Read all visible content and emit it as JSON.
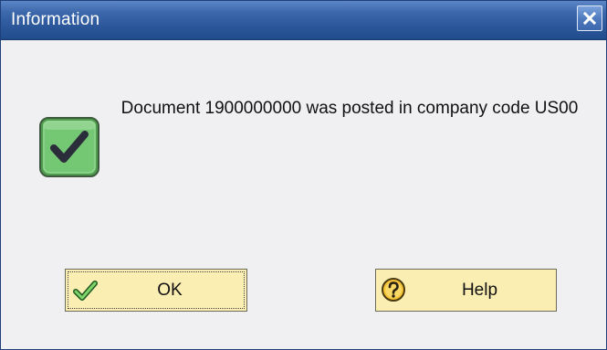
{
  "window": {
    "title": "Information",
    "close_icon": "close-icon"
  },
  "dialog": {
    "message": "Document 1900000000 was posted in company code US00",
    "status_icon": "checkmark-success-icon"
  },
  "buttons": {
    "ok": {
      "label": "OK",
      "icon": "checkmark-icon"
    },
    "help": {
      "label": "Help",
      "icon": "help-question-icon"
    }
  },
  "colors": {
    "titlebar": "#2a5699",
    "button_face": "#fbeeb2",
    "success_icon": "#6ac56a",
    "dialog_background": "#f0f0f2"
  }
}
